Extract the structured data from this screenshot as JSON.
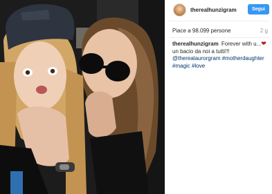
{
  "post": {
    "username": "therealhunzigram",
    "follow_label": "Segui",
    "likes_text": "Piace a 98.099 persone",
    "time_ago": "2 g",
    "caption": {
      "author": "therealhunzigram",
      "line_1": "Forever with u...",
      "heart": "❤",
      "line_2": "un bacio da noi a tutti!!!",
      "mention": "@therealaurorgram",
      "tag_1": "#motherdaughter",
      "tag_2": "#magic",
      "tag_3": "#love"
    }
  },
  "colors": {
    "follow_button": "#3897f0",
    "hashtag": "#003569",
    "heart": "#b71c1c"
  }
}
